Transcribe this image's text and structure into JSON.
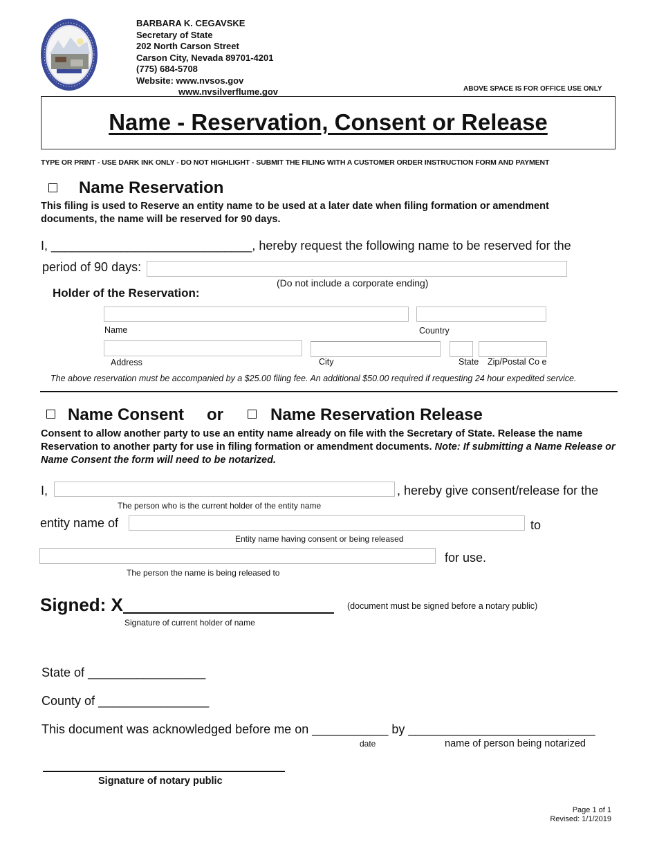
{
  "header": {
    "seal_icon": "nevada-state-seal-icon",
    "official_name": "BARBARA K. CEGAVSKE",
    "official_title": "Secretary of State",
    "street": "202 North Carson Street",
    "city_state_zip": "Carson City, Nevada 89701-4201",
    "phone": "(775) 684-5708",
    "website_1": "Website: www.nvsos.gov",
    "website_2": "www.nvsilverflume.gov",
    "office_use": "ABOVE SPACE IS FOR OFFICE USE ONLY"
  },
  "form_title": "Name - Reservation, Consent or Release",
  "instructions": "TYPE OR PRINT - USE DARK INK ONLY - DO NOT HIGHLIGHT - SUBMIT THE FILING WITH A CUSTOMER ORDER INSTRUCTION FORM AND PAYMENT",
  "reservation": {
    "heading": "Name Reservation",
    "checked": false,
    "description": "This filing is used to Reserve an entity name to be used at a later date when filing formation or amendment documents, the name will be reserved for 90 days.",
    "line1_prefix": "I, ",
    "line1_blank": "_____________________________",
    "line1_suffix": ", hereby  request the following name to be reserved for the",
    "period_label": "period of 90 days:",
    "period_value": "",
    "period_hint": "(Do not include a corporate ending)",
    "holder_heading": "Holder of the Reservation:",
    "fields": {
      "name_label": "Name",
      "name_value": "",
      "country_label": "Country",
      "country_value": "",
      "address_label": "Address",
      "address_value": "",
      "city_label": "City",
      "city_value": "",
      "state_label": "State",
      "state_value": "",
      "zip_label": "Zip/Postal Co  e",
      "zip_value": ""
    },
    "fee_note": "The above reservation must be accompanied by a $25.00 filing fee. An additional $50.00 required if  requesting 24 hour expedited service."
  },
  "consent": {
    "consent_heading": "Name Consent",
    "consent_checked": false,
    "or_text": "or",
    "release_heading": "Name Reservation Release",
    "release_checked": false,
    "description_bold": "Consent to allow another party to use an entity name already on file with the Secretary of State.  Release the name Reservation to another party for use in filing formation or amendment documents. ",
    "description_italic": "Note: If submitting a Name Release or Name Consent the form will need to be notarized.",
    "line1_prefix": "I,",
    "holder_value": "",
    "line1_suffix": ", hereby give consent/release for the",
    "holder_hint": "The person who is the current holder of the entity name",
    "entity_label": "entity name of",
    "entity_value": "",
    "entity_suffix": "to",
    "entity_hint": "Entity name having consent or being released",
    "recipient_value": "",
    "recipient_suffix": "for use.",
    "recipient_hint": "The person the name is being released to"
  },
  "signature": {
    "signed_label": "Signed: X",
    "signed_note": "(document must be signed before a notary public)",
    "signed_hint": "Signature of current holder of name"
  },
  "notary": {
    "state_label": "State of",
    "state_blank": "_________________",
    "county_label": "County of",
    "county_blank": "________________",
    "ack_text": "This document was acknowledged before me on",
    "date_blank": "___________",
    "by_text": "by",
    "person_blank": "___________________________",
    "date_hint": "date",
    "person_hint": "name of person being notarized",
    "notary_sig_label": "Signature of notary public"
  },
  "footer": {
    "page": "Page 1 of 1",
    "revised": "Revised: 1/1/2019"
  }
}
